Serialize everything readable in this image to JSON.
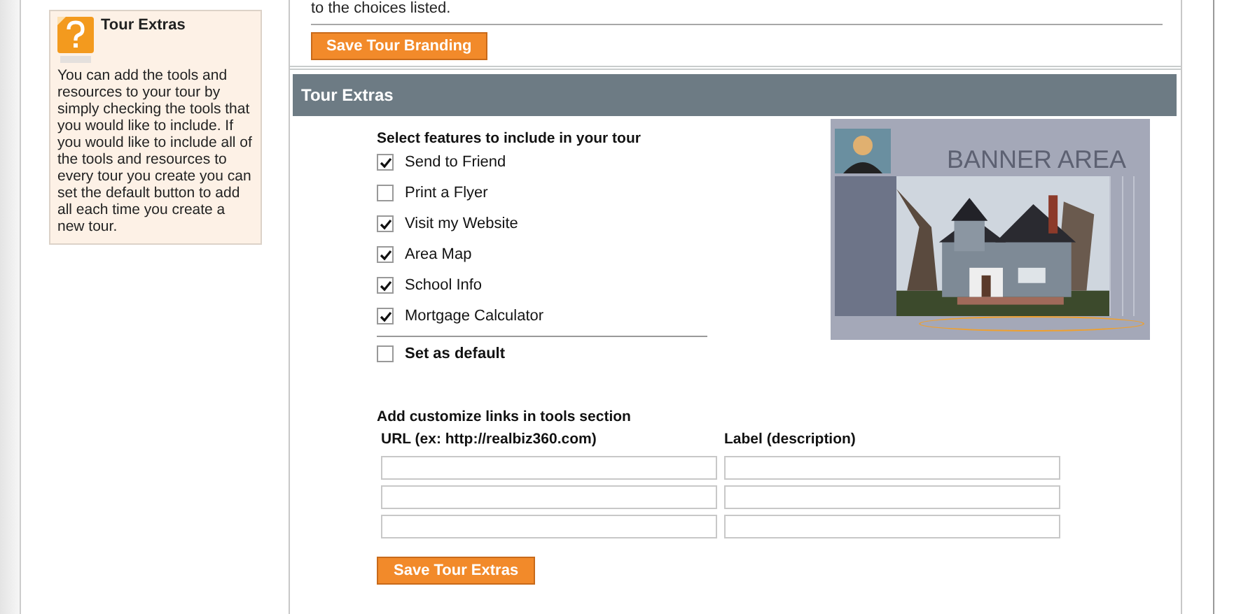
{
  "help": {
    "title": "Tour Extras",
    "text": "You can add the tools and resources to your tour by simply checking the tools that you would like to include. If you would like to include all of the tools and resources to every tour you create you can set the default button to add all each time you create a new tour."
  },
  "branding": {
    "note": "to the choices listed.",
    "button": "Save Tour Branding"
  },
  "section": {
    "title": "Tour Extras",
    "features_heading": "Select features to include in your tour",
    "features": [
      {
        "label": "Send to Friend",
        "checked": true
      },
      {
        "label": "Print a Flyer",
        "checked": false
      },
      {
        "label": "Visit my Website",
        "checked": true
      },
      {
        "label": "Area Map",
        "checked": true
      },
      {
        "label": "School Info",
        "checked": true
      },
      {
        "label": "Mortgage Calculator",
        "checked": true
      }
    ],
    "default": {
      "label": "Set as default",
      "checked": false
    },
    "preview": {
      "banner": "BANNER AREA"
    },
    "links_heading": "Add customize links in tools section",
    "columns": [
      "URL (ex: http://realbiz360.com)",
      "Label (description)"
    ],
    "button": "Save Tour Extras"
  }
}
